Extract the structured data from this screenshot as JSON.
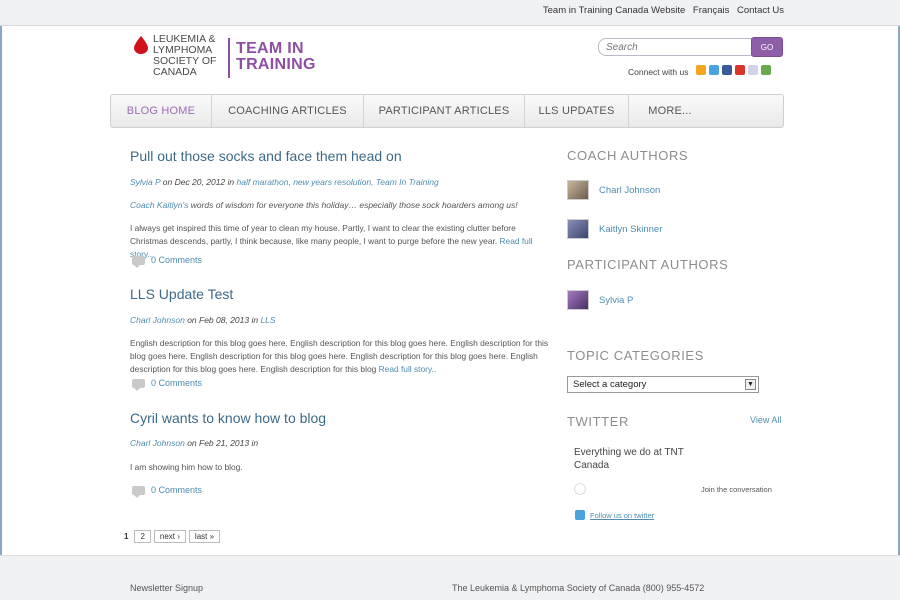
{
  "topbar": {
    "links": [
      "Team in Training Canada Website",
      "Français",
      "Contact Us"
    ]
  },
  "logo": {
    "lls_text": "LEUKEMIA & LYMPHOMA SOCIETY OF CANADA",
    "tnt_line1": "TEAM IN",
    "tnt_line2": "TRAINING"
  },
  "search": {
    "placeholder": "Search",
    "go_label": "GO"
  },
  "connect": {
    "label": "Connect with us",
    "icons": [
      {
        "name": "rss-icon",
        "color": "#f5a623"
      },
      {
        "name": "twitter-icon",
        "color": "#4aa3df"
      },
      {
        "name": "facebook-icon",
        "color": "#3b5998"
      },
      {
        "name": "youtube-icon",
        "color": "#d9362b"
      },
      {
        "name": "flickr-icon",
        "color": "#d3d3e8"
      },
      {
        "name": "share-icon",
        "color": "#6aa84f"
      }
    ]
  },
  "nav": {
    "items": [
      "BLOG HOME",
      "COACHING ARTICLES",
      "PARTICIPANT ARTICLES",
      "LLS UPDATES",
      "MORE..."
    ]
  },
  "posts": [
    {
      "title": "Pull out those socks and face them head on",
      "author": "Sylvia P",
      "date": "on Dec 20, 2012 in",
      "tags": "half marathon, new years resolution, Team In Training",
      "excerpt_link": "Coach Kaitlyn's",
      "excerpt_text": " words of wisdom for everyone this holiday… especially those sock hoarders among us!",
      "body": "I always get inspired this time of year to clean my house. Partly, I want to clear the existing clutter before Christmas descends, partly, I think because, like many people, I want to purge before the new year.",
      "read_more": "Read full story..",
      "comments": "0 Comments"
    },
    {
      "title": "LLS Update Test",
      "author": "Charl Johnson",
      "date": "on Feb 08, 2013 in",
      "tags": "LLS",
      "body": "English description for this blog goes here.  English description for this blog goes here. English description for this blog goes here. English description for this blog goes here. English description for this blog goes here. English description for this blog goes here. English description for this blog",
      "read_more": "Read full story..",
      "comments": "0 Comments"
    },
    {
      "title": "Cyril wants to know how to blog",
      "author": "Charl Johnson",
      "date": "on Feb 21, 2013 in",
      "body": "I am showing him how to blog.",
      "comments": "0 Comments"
    }
  ],
  "pager": {
    "current": "1",
    "page2": "2",
    "next": "next ›",
    "last": "last »"
  },
  "sidebar": {
    "coach_heading": "COACH AUTHORS",
    "coaches": [
      "Charl Johnson",
      "Kaitlyn Skinner"
    ],
    "participant_heading": "PARTICIPANT AUTHORS",
    "participants": [
      "Sylvia P"
    ],
    "topic_heading": "TOPIC CATEGORIES",
    "category_select": "Select a category",
    "twitter_heading": "TWITTER",
    "view_all": "View All",
    "tweet": "Everything we do at TNT Canada",
    "join": "Join the conversation",
    "follow": "Follow us on twitter"
  },
  "footer": {
    "newsletter": "Newsletter Signup",
    "org": "The Leukemia & Lymphoma Society of Canada (800) 955-4572"
  }
}
